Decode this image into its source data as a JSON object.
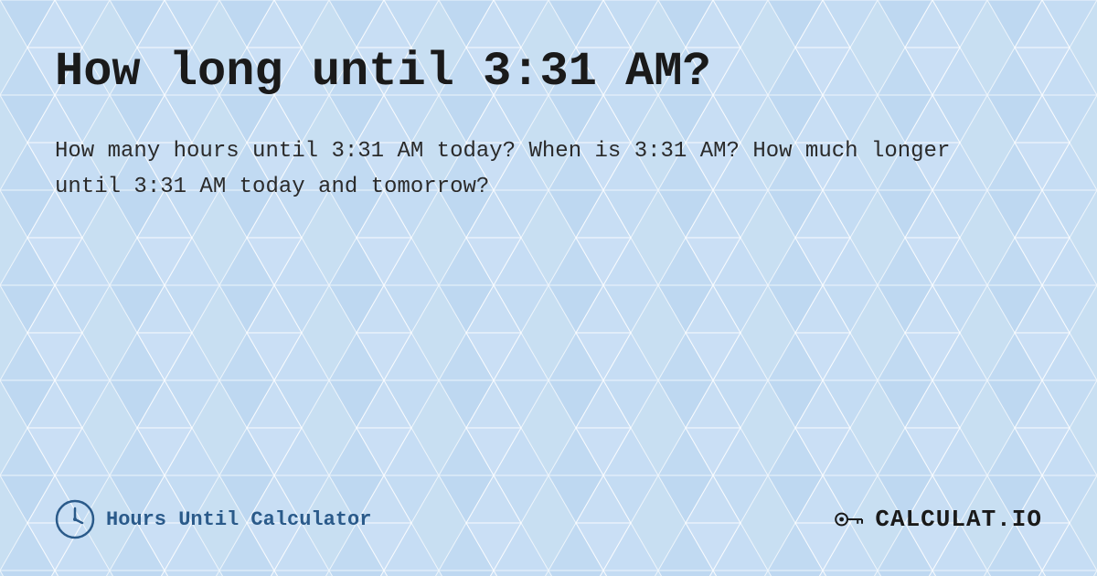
{
  "page": {
    "title": "How long until 3:31 AM?",
    "description": "How many hours until 3:31 AM today? When is 3:31 AM? How much longer until 3:31 AM today and tomorrow?",
    "footer": {
      "brand_text": "Hours Until Calculator",
      "logo_text": "CALCULAT.IO"
    },
    "background_color": "#cce0f5",
    "accent_color": "#2a5a8a"
  }
}
